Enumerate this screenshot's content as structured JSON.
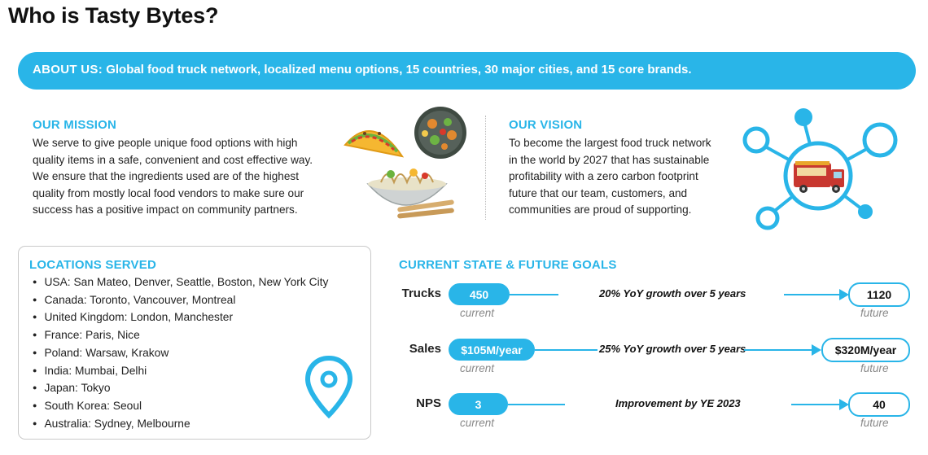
{
  "page_title": "Who is Tasty Bytes?",
  "about": {
    "label": "ABOUT US:",
    "text": "Global food truck network,  localized menu options, 15 countries, 30 major cities, and 15 core brands."
  },
  "mission": {
    "title": "OUR MISSION",
    "lines": [
      "We serve to give people unique food options with high",
      "quality items in a safe,  convenient and cost effective way.",
      "We ensure that the ingredients used are of the highest",
      "quality from mostly local food vendors to make sure our",
      "success has a positive impact on community partners."
    ]
  },
  "vision": {
    "title": "OUR VISION",
    "lines": [
      "To become the largest food truck network",
      "in the world by 2027 that has sustainable",
      "profitability with a zero carbon footprint",
      "future that our team, customers, and",
      "communities are proud of supporting."
    ]
  },
  "locations": {
    "title": "LOCATIONS SERVED",
    "items": [
      "USA: San Mateo, Denver, Seattle, Boston, New York City",
      "Canada: Toronto, Vancouver, Montreal",
      "United Kingdom: London, Manchester",
      "France: Paris, Nice",
      "Poland: Warsaw, Krakow",
      "India: Mumbai, Delhi",
      "Japan: Tokyo",
      "South Korea: Seoul",
      "Australia: Sydney, Melbourne"
    ]
  },
  "goals": {
    "title": "CURRENT STATE & FUTURE GOALS",
    "current_label": "current",
    "future_label": "future",
    "rows": [
      {
        "label": "Trucks",
        "current": "450",
        "growth": "20% YoY growth over 5 years",
        "future": "1120"
      },
      {
        "label": "Sales",
        "current": "$105M/year",
        "growth": "25% YoY growth over 5 years",
        "future": "$320M/year"
      },
      {
        "label": "NPS",
        "current": "3",
        "growth": "Improvement by YE 2023",
        "future": "40"
      }
    ]
  },
  "icons": {
    "food": "food-illustration-icon",
    "network": "food-truck-network-icon",
    "location": "map-pin-icon"
  },
  "colors": {
    "accent": "#29b5e8"
  }
}
